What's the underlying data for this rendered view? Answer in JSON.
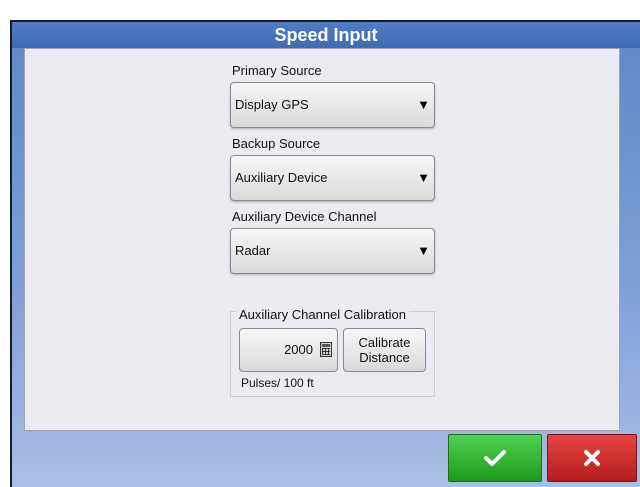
{
  "dialog": {
    "title": "Speed Input"
  },
  "primary_source": {
    "label": "Primary Source",
    "value": "Display GPS"
  },
  "backup_source": {
    "label": "Backup Source",
    "value": "Auxiliary Device"
  },
  "aux_channel": {
    "label": "Auxiliary Device Channel",
    "value": "Radar"
  },
  "calibration": {
    "title": "Auxiliary Channel Calibration",
    "value": "2000",
    "calibrate_label": "Calibrate Distance",
    "unit": "Pulses/ 100 ft"
  },
  "footer": {
    "ok_icon": "checkmark-icon",
    "cancel_icon": "x-icon"
  },
  "colors": {
    "title_bar": "#4a78c2",
    "ok": "#2bb52b",
    "cancel": "#cc2a2a"
  },
  "icons": {
    "dropdown": "triangle-down-icon",
    "calculator": "calculator-icon"
  }
}
